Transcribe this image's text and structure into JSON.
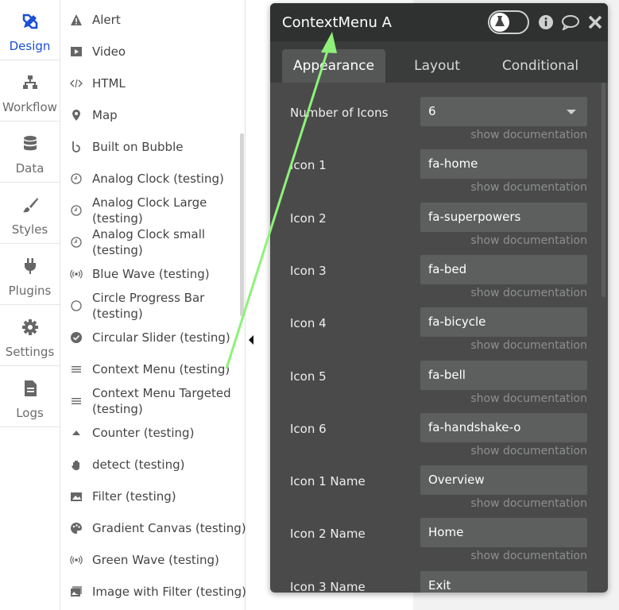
{
  "nav": {
    "items": [
      {
        "label": "Design",
        "icon": "design-icon",
        "active": true
      },
      {
        "label": "Workflow",
        "icon": "workflow-icon"
      },
      {
        "label": "Data",
        "icon": "database-icon"
      },
      {
        "label": "Styles",
        "icon": "brush-icon"
      },
      {
        "label": "Plugins",
        "icon": "plug-icon"
      },
      {
        "label": "Settings",
        "icon": "gear-icon"
      },
      {
        "label": "Logs",
        "icon": "document-icon"
      }
    ],
    "accent": "#1a4fd6"
  },
  "elements": [
    {
      "label": "Alert",
      "icon": "warning-icon"
    },
    {
      "label": "Video",
      "icon": "play-icon"
    },
    {
      "label": "HTML",
      "icon": "code-icon"
    },
    {
      "label": "Map",
      "icon": "map-pin-icon"
    },
    {
      "label": "Built on Bubble",
      "icon": "bubble-icon"
    },
    {
      "label": "Analog Clock (testing)",
      "icon": "clock-icon"
    },
    {
      "label": "Analog Clock Large\n(testing)",
      "icon": "clock-icon"
    },
    {
      "label": "Analog Clock small\n(testing)",
      "icon": "clock-icon"
    },
    {
      "label": "Blue Wave (testing)",
      "icon": "wave-icon"
    },
    {
      "label": "Circle Progress Bar\n(testing)",
      "icon": "circle-icon"
    },
    {
      "label": "Circular Slider (testing)",
      "icon": "check-circle-icon"
    },
    {
      "label": "Context Menu (testing)",
      "icon": "menu-icon"
    },
    {
      "label": "Context Menu Targeted\n(testing)",
      "icon": "menu-icon"
    },
    {
      "label": "Counter (testing)",
      "icon": "caret-up-icon"
    },
    {
      "label": "detect (testing)",
      "icon": "hand-icon"
    },
    {
      "label": "Filter (testing)",
      "icon": "image-icon"
    },
    {
      "label": "Gradient Canvas (testing)",
      "icon": "palette-icon"
    },
    {
      "label": "Green Wave (testing)",
      "icon": "wave-icon"
    },
    {
      "label": "Image with Filter (testing)",
      "icon": "image-filter-icon"
    }
  ],
  "editor": {
    "title": "ContextMenu A",
    "tabs": [
      "Appearance",
      "Layout",
      "Conditional"
    ],
    "active_tab": "Appearance",
    "doc_link": "show documentation",
    "properties": [
      {
        "label": "Number of Icons",
        "value": "6",
        "dropdown": true
      },
      {
        "label": "Icon 1",
        "value": "fa-home"
      },
      {
        "label": "Icon 2",
        "value": "fa-superpowers"
      },
      {
        "label": "Icon 3",
        "value": "fa-bed"
      },
      {
        "label": "Icon 4",
        "value": "fa-bicycle"
      },
      {
        "label": "Icon 5",
        "value": "fa-bell"
      },
      {
        "label": "Icon 6",
        "value": "fa-handshake-o"
      },
      {
        "label": "Icon 1 Name",
        "value": "Overview"
      },
      {
        "label": "Icon 2 Name",
        "value": "Home"
      },
      {
        "label": "Icon 3 Name",
        "value": "Exit"
      }
    ],
    "header_icons": [
      "flask-icon",
      "info-icon",
      "comment-icon",
      "close-icon"
    ]
  },
  "colors": {
    "arrow": "#8ef27a",
    "panel": "#4a4a4a",
    "header": "#2f3131"
  }
}
